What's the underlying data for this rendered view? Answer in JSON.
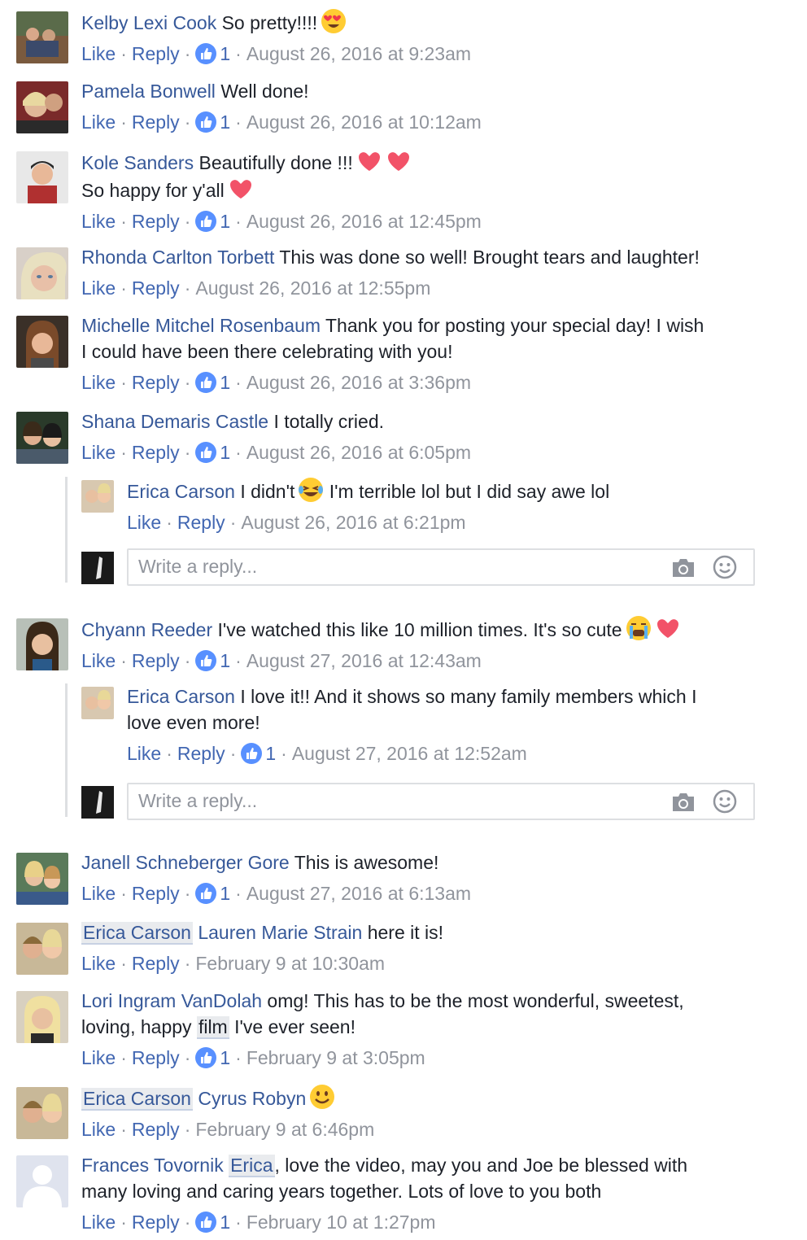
{
  "action_labels": {
    "like": "Like",
    "reply": "Reply",
    "separator": "·"
  },
  "colors": {
    "author": "#365899",
    "link": "#4267b2",
    "meta": "#90949c",
    "like_badge": "#5890ff"
  },
  "comments": [
    {
      "author": "Kelby Lexi Cook",
      "text": "So pretty!!!!",
      "emoji": "heart-eyes-icon",
      "likes": "1",
      "timestamp": "August 26, 2016 at 9:23am"
    },
    {
      "author": "Pamela Bonwell",
      "text": "Well done!",
      "likes": "1",
      "timestamp": "August 26, 2016 at 10:12am"
    },
    {
      "author": "Kole Sanders",
      "text": "Beautifully done !!!",
      "text2": "So happy for y'all",
      "likes": "1",
      "timestamp": "August 26, 2016 at 12:45pm"
    },
    {
      "author": "Rhonda Carlton Torbett",
      "text": "This was done so well! Brought tears and laughter!",
      "likes": "",
      "timestamp": "August 26, 2016 at 12:55pm"
    },
    {
      "author": "Michelle Mitchel Rosenbaum",
      "text": "Thank you for posting your special day! I wish",
      "text2": "I could have been there celebrating with you!",
      "likes": "1",
      "timestamp": "August 26, 2016 at 3:36pm"
    },
    {
      "author": "Shana Demaris Castle",
      "text": "I totally cried.",
      "likes": "1",
      "timestamp": "August 26, 2016 at 6:05pm"
    },
    {
      "author": "Erica Carson",
      "text": "I didn't",
      "text_after": "I'm terrible lol but I did say awe lol",
      "likes": "",
      "timestamp": "August 26, 2016 at 6:21pm"
    },
    {
      "author": "Chyann Reeder",
      "text": "I've watched this like 10 million times. It's so cute",
      "likes": "1",
      "timestamp": "August 27, 2016 at 12:43am"
    },
    {
      "author": "Erica Carson",
      "text": "I love it!! And it shows so many family members which I",
      "text2": "love even more!",
      "likes": "1",
      "timestamp": "August 27, 2016 at 12:52am"
    },
    {
      "author": "Janell Schneberger Gore",
      "text": "This is awesome!",
      "likes": "1",
      "timestamp": "August 27, 2016 at 6:13am"
    },
    {
      "author": "Erica Carson",
      "mention": "Lauren Marie Strain",
      "text": "here it is!",
      "likes": "",
      "timestamp": "February 9 at 10:30am"
    },
    {
      "author": "Lori Ingram VanDolah",
      "text": "omg! This has to be the most wonderful, sweetest,",
      "text2a": "loving, happy",
      "mention": "film",
      "text2b": "I've ever seen!",
      "likes": "1",
      "timestamp": "February 9 at 3:05pm"
    },
    {
      "author": "Erica Carson",
      "mention": "Cyrus Robyn",
      "likes": "",
      "timestamp": "February 9 at 6:46pm"
    },
    {
      "author": "Frances Tovornik",
      "mention": "Erica",
      "text": ", love the video, may you and Joe be blessed with",
      "text2": "many loving and caring years together. Lots of love to you both",
      "likes": "1",
      "timestamp": "February 10 at 1:27pm"
    }
  ],
  "reply_box": {
    "placeholder": "Write a reply..."
  }
}
